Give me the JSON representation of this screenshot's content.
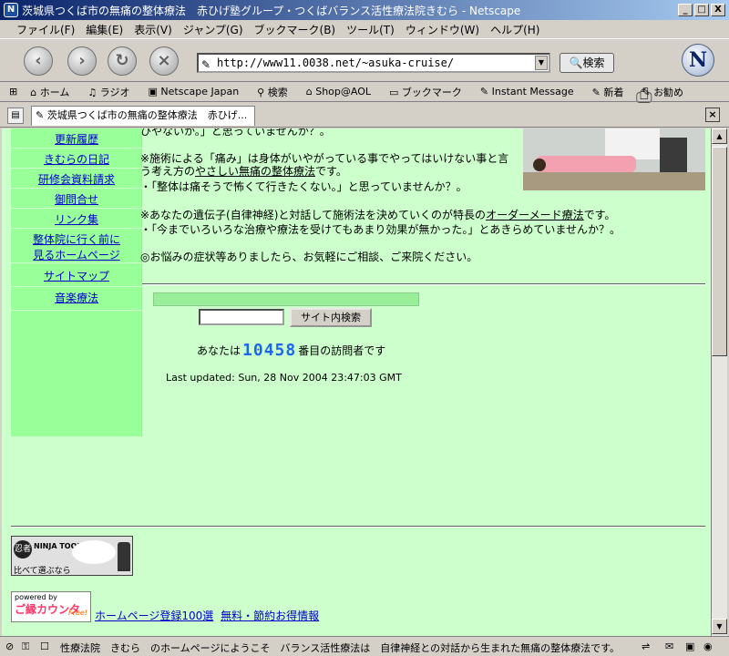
{
  "window": {
    "title": "茨城県つくば市の無痛の整体療法　赤ひげ塾グループ・つくばバランス活性療法院きむら - Netscape",
    "minimize": "_",
    "maximize": "□",
    "close": "X"
  },
  "menu": [
    "ファイル(F)",
    "編集(E)",
    "表示(V)",
    "ジャンプ(G)",
    "ブックマーク(B)",
    "ツール(T)",
    "ウィンドウ(W)",
    "ヘルプ(H)"
  ],
  "navigation": {
    "url": "http://www11.0038.net/~asuka-cruise/",
    "search_label": "検索",
    "logo": "N"
  },
  "bookmarks": [
    "ホーム",
    "ラジオ",
    "Netscape Japan",
    "検索",
    "Shop@AOL",
    "ブックマーク",
    "Instant Message",
    "新着",
    "お勧め"
  ],
  "tab": {
    "label": "茨城県つくば市の無痛の整体療法　赤ひげ..."
  },
  "sidebar": {
    "items": [
      {
        "label": "更新履歴"
      },
      {
        "label": "きむらの日記"
      },
      {
        "label": "研修会資料請求"
      },
      {
        "label": "御問合せ"
      },
      {
        "label": "リンク集"
      },
      {
        "label": "整体院に行く前に"
      },
      {
        "label": "見るホームページ"
      },
      {
        "label": "サイトマップ"
      },
      {
        "label": "音楽療法"
      }
    ]
  },
  "main": {
    "partial_top": "ひやないか。」と思っていませんか？。",
    "p1_line1": "※施術による「痛み」は身体がいやがっている事でやってはいけない事と言",
    "p1_line2_a": "う考え方の",
    "p1_line2_link": "やさしい無痛の整体療法",
    "p1_line2_b": "です。",
    "p1_line3": "・「整体は痛そうで怖くて行きたくない。」と思っていませんか？。",
    "p2_line1_a": "※あなたの遺伝子(自律神経)と対話して施術法を決めていくのが特長の",
    "p2_line1_link": "オーダーメード療法",
    "p2_line1_b": "です。",
    "p2_line2": "・「今までいろいろな治療や療法を受けてもあまり効果が無かった。」とあきらめていませんか？。",
    "p3": "◎お悩みの症状等ありましたら、お気軽にご相談、ご来院ください。",
    "search_button": "サイト内検索",
    "visitor_prefix": "あなたは",
    "visitor_count": "10458",
    "visitor_suffix": "番目の訪問者です",
    "last_updated": "Last updated: Sun, 28 Nov 2004 23:47:03 GMT"
  },
  "footer": {
    "ninja_logo": "忍者",
    "ninja_name": "NINJA TOOLS",
    "ninja_caption": "比べて選ぶなら",
    "kawa_powered": "powered by",
    "kawa_name": "ご縁カウンタ",
    "kawa_free": "Free!",
    "link1": "ホームページ登録100選",
    "link2": "無料・節約お得情報"
  },
  "status": {
    "text": "性療法院　きむら　のホームページにようこそ　バランス活性療法は　自律神経との対話から生まれた無痛の整体療法です。"
  }
}
